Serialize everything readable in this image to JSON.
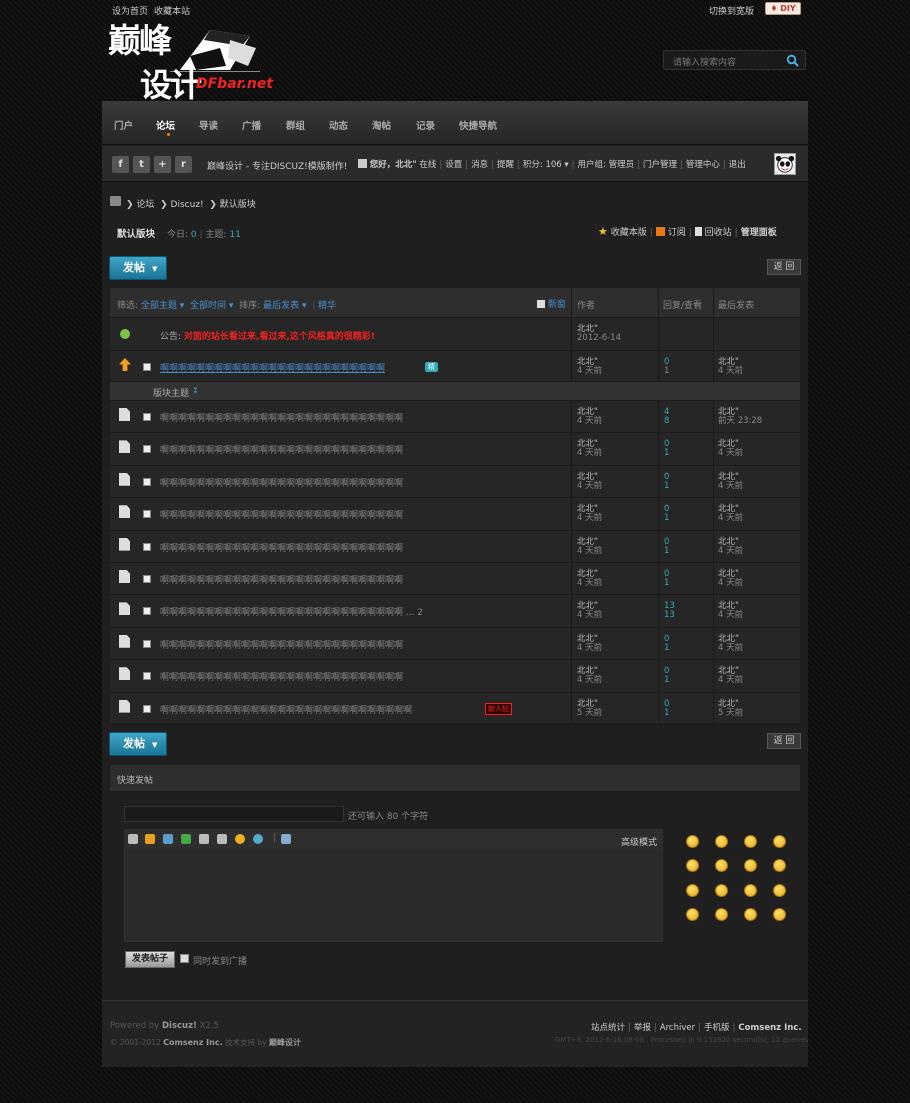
{
  "topbar": {
    "links": [
      "设为首页",
      "收藏本站"
    ],
    "wide": "切换到宽版",
    "diy": "♦ DIY"
  },
  "logo": {
    "cn": "巅峰",
    "cn2": "设计",
    "net": "DFbar.net"
  },
  "search": {
    "placeholder": "请输入搜索内容"
  },
  "nav": [
    "门户",
    "论坛",
    "导读",
    "广播",
    "群组",
    "动态",
    "淘帖",
    "记录",
    "快捷导航"
  ],
  "social": [
    "f",
    "t",
    "+",
    "r"
  ],
  "slogan": "巅峰设计 - 专注DISCUZ!模版制作!",
  "userbar": {
    "greeting": "您好，北北\"",
    "online": "在线",
    "items": [
      "设置",
      "消息",
      "提醒"
    ],
    "points": "积分: 106 ▾",
    "group": "用户组: 管理员",
    "portal": "门户管理",
    "admin": "管理中心",
    "logout": "退出"
  },
  "breadcrumb": [
    "论坛",
    "Discuz!",
    "默认版块"
  ],
  "forum": {
    "name": "默认版块",
    "today_label": "今日:",
    "today": "0",
    "threads_label": "主题:",
    "threads": "11",
    "actions": [
      "收藏本版",
      "订阅",
      "回收站",
      "管理面板"
    ]
  },
  "buttons": {
    "post": "发帖",
    "back": "返 回"
  },
  "filter": {
    "label": "筛选:",
    "all": "全部主题 ▾",
    "time": "全部时间 ▾",
    "sort_label": "排序:",
    "sort": "最后发表 ▾",
    "digest": "精华",
    "new_window": "新窗"
  },
  "headers": {
    "author": "作者",
    "replies": "回复/查看",
    "last": "最后发表"
  },
  "announcement": {
    "label": "公告:",
    "text": "对面的站长看过来,看过来,这个风格真的很精彩!",
    "author": "北北\"",
    "date": "2012-6-14"
  },
  "sticky": {
    "title": "啊啊啊啊啊啊啊啊啊啊啊啊啊啊啊啊啊啊啊啊啊啊啊啊啊",
    "badge": "精",
    "author": "北北\"",
    "adate": "4 天前",
    "replies": "0",
    "views": "1",
    "last": "北北\"",
    "ldate": "4 天前"
  },
  "section_label": "版块主题",
  "threads": [
    {
      "title": "啊啊啊啊啊啊啊啊啊啊啊啊啊啊啊啊啊啊啊啊啊啊啊啊啊啊啊",
      "author": "北北\"",
      "adate": "4 天前",
      "replies": "4",
      "views": "8",
      "last": "北北\"",
      "ldate": "前天 23:28"
    },
    {
      "title": "啊啊啊啊啊啊啊啊啊啊啊啊啊啊啊啊啊啊啊啊啊啊啊啊啊啊啊",
      "author": "北北\"",
      "adate": "4 天前",
      "replies": "0",
      "views": "1",
      "last": "北北\"",
      "ldate": "4 天前"
    },
    {
      "title": "啊啊啊啊啊啊啊啊啊啊啊啊啊啊啊啊啊啊啊啊啊啊啊啊啊啊啊",
      "author": "北北\"",
      "adate": "4 天前",
      "replies": "0",
      "views": "1",
      "last": "北北\"",
      "ldate": "4 天前"
    },
    {
      "title": "啊啊啊啊啊啊啊啊啊啊啊啊啊啊啊啊啊啊啊啊啊啊啊啊啊啊啊",
      "author": "北北\"",
      "adate": "4 天前",
      "replies": "0",
      "views": "1",
      "last": "北北\"",
      "ldate": "4 天前"
    },
    {
      "title": "啊啊啊啊啊啊啊啊啊啊啊啊啊啊啊啊啊啊啊啊啊啊啊啊啊啊啊",
      "author": "北北\"",
      "adate": "4 天前",
      "replies": "0",
      "views": "1",
      "last": "北北\"",
      "ldate": "4 天前"
    },
    {
      "title": "啊啊啊啊啊啊啊啊啊啊啊啊啊啊啊啊啊啊啊啊啊啊啊啊啊啊啊",
      "author": "北北\"",
      "adate": "4 天前",
      "replies": "0",
      "views": "1",
      "last": "北北\"",
      "ldate": "4 天前"
    },
    {
      "title": "啊啊啊啊啊啊啊啊啊啊啊啊啊啊啊啊啊啊啊啊啊啊啊啊啊啊啊 ... 2",
      "author": "北北\"",
      "adate": "4 天前",
      "replies": "13",
      "views": "13",
      "last": "北北\"",
      "ldate": "4 天前"
    },
    {
      "title": "啊啊啊啊啊啊啊啊啊啊啊啊啊啊啊啊啊啊啊啊啊啊啊啊啊啊啊",
      "author": "北北\"",
      "adate": "4 天前",
      "replies": "0",
      "views": "1",
      "last": "北北\"",
      "ldate": "4 天前"
    },
    {
      "title": "啊啊啊啊啊啊啊啊啊啊啊啊啊啊啊啊啊啊啊啊啊啊啊啊啊啊啊",
      "author": "北北\"",
      "adate": "4 天前",
      "replies": "0",
      "views": "1",
      "last": "北北\"",
      "ldate": "4 天前"
    },
    {
      "title": "啊啊啊啊啊啊啊啊啊啊啊啊啊啊啊啊啊啊啊啊啊啊啊啊啊啊啊啊",
      "badge": "新人帖",
      "author": "北北\"",
      "adate": "5 天前",
      "replies": "0",
      "views": "1",
      "last": "北北\"",
      "ldate": "5 天前"
    }
  ],
  "quick": {
    "title": "快速发帖",
    "hint": "还可输入 80 个字符",
    "advanced": "高级模式",
    "submit": "发表帖子",
    "broadcast": "同时发到广播"
  },
  "footer": {
    "powered": "Powered by",
    "discuz": "Discuz!",
    "ver": "X2.5",
    "copy": "© 2001-2012",
    "comsenz": "Comsenz Inc.",
    "tech": "技术支持 by",
    "designer": "巅峰设计",
    "links": [
      "站点统计",
      "举报",
      "Archiver",
      "手机版",
      "Comsenz Inc."
    ],
    "gmt": "GMT+8, 2012-6-18 08:08 , Processed in 0.153920 second(s), 12 queries ."
  }
}
